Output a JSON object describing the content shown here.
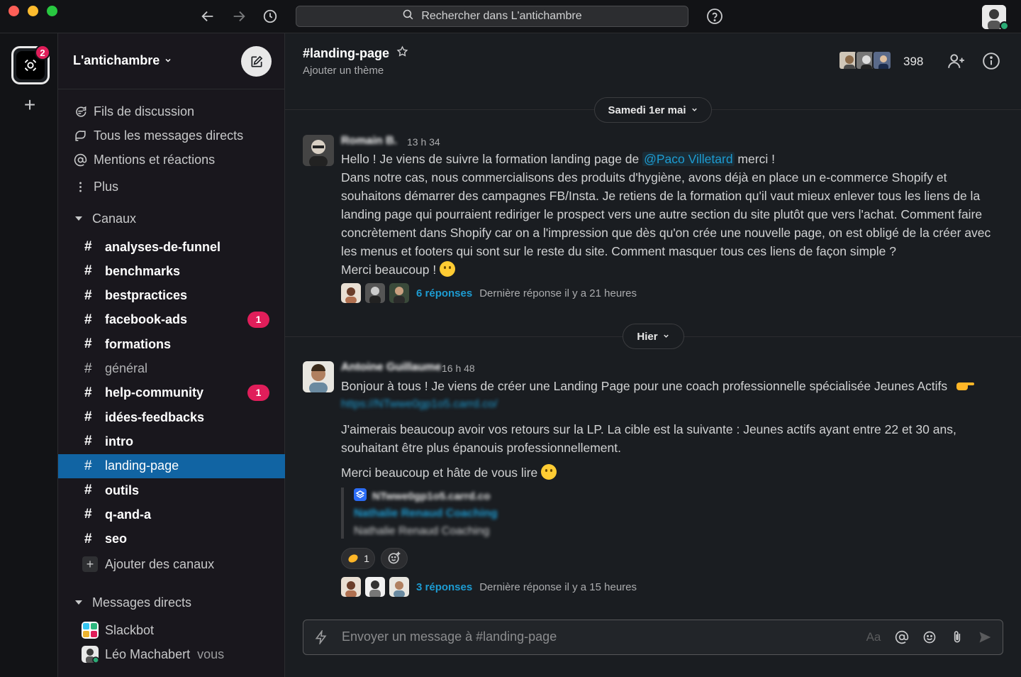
{
  "search": {
    "placeholder": "Rechercher dans L'antichambre"
  },
  "workspace": {
    "name": "L'antichambre",
    "badge": "2"
  },
  "sidebar": {
    "nav": [
      {
        "label": "Fils de discussion",
        "icon": "threads-icon"
      },
      {
        "label": "Tous les messages directs",
        "icon": "dm-icon"
      },
      {
        "label": "Mentions et réactions",
        "icon": "at-icon"
      },
      {
        "label": "Plus",
        "icon": "more-vertical-icon"
      }
    ],
    "channels_section": "Canaux",
    "channels": [
      {
        "name": "analyses-de-funnel",
        "state": "bold",
        "badge": ""
      },
      {
        "name": "benchmarks",
        "state": "bold",
        "badge": ""
      },
      {
        "name": "bestpractices",
        "state": "bold",
        "badge": ""
      },
      {
        "name": "facebook-ads",
        "state": "bold",
        "badge": "1"
      },
      {
        "name": "formations",
        "state": "bold",
        "badge": ""
      },
      {
        "name": "général",
        "state": "muted",
        "badge": ""
      },
      {
        "name": "help-community",
        "state": "bold",
        "badge": "1"
      },
      {
        "name": "idées-feedbacks",
        "state": "bold",
        "badge": ""
      },
      {
        "name": "intro",
        "state": "bold",
        "badge": ""
      },
      {
        "name": "landing-page",
        "state": "active",
        "badge": ""
      },
      {
        "name": "outils",
        "state": "bold",
        "badge": ""
      },
      {
        "name": "q-and-a",
        "state": "bold",
        "badge": ""
      },
      {
        "name": "seo",
        "state": "bold",
        "badge": ""
      }
    ],
    "add_channels": "Ajouter des canaux",
    "dm_section": "Messages directs",
    "dms": [
      {
        "name": "Slackbot",
        "sub": ""
      },
      {
        "name": "Léo Machabert",
        "sub": "vous"
      }
    ]
  },
  "channel": {
    "title": "#landing-page",
    "topic": "Ajouter un thème",
    "member_count": "398"
  },
  "messages": {
    "date1": "Samedi 1er mai",
    "date2": "Hier",
    "m1": {
      "sender": "Romain B.",
      "time": "13 h 34",
      "line1_pre": "Hello ! Je viens de suivre la formation landing page de ",
      "mention": "@Paco Villetard",
      "line1_post": " merci !",
      "body": "Dans notre cas, nous commercialisons des produits d'hygiène, avons déjà en place un e-commerce Shopify et souhaitons démarrer des campagnes FB/Insta. Je retiens de la formation qu'il vaut mieux enlever tous les liens de la landing page qui pourraient rediriger le prospect vers une autre section du site plutôt que vers l'achat. Comment faire concrètement dans Shopify car on a l'impression que dès qu'on crée une nouvelle page, on est obligé de la créer avec les menus et footers qui sont sur le reste du site. Comment masquer tous ces liens de façon simple ?",
      "closing": "Merci beaucoup ! ",
      "replies": "6 réponses",
      "last_reply": "Dernière réponse il y a 21 heures"
    },
    "m2": {
      "sender": "Antoine Guillaume",
      "time": "16 h 48",
      "line1": "Bonjour à tous ! Je viens de créer une Landing Page pour une coach professionnelle spécialisée Jeunes Actifs",
      "link": "https://NTwwe0gp1o5.carrd.co/",
      "para2": "J'aimerais beaucoup avoir vos retours sur la LP. La cible est la suivante : Jeunes actifs ayant entre 22 et 30 ans, souhaitant être plus épanouis professionnellement.",
      "para3": "Merci beaucoup et hâte de vous lire ",
      "unfurl_site": "NTwwe0gp1o5.carrd.co",
      "unfurl_title": "Nathalie Renaud Coaching",
      "unfurl_desc": "Nathalie Renaud Coaching",
      "reaction_count": "1",
      "replies": "3 réponses",
      "last_reply": "Dernière réponse il y a 15 heures"
    }
  },
  "composer": {
    "placeholder": "Envoyer un message à #landing-page",
    "format_label": "Aa"
  }
}
